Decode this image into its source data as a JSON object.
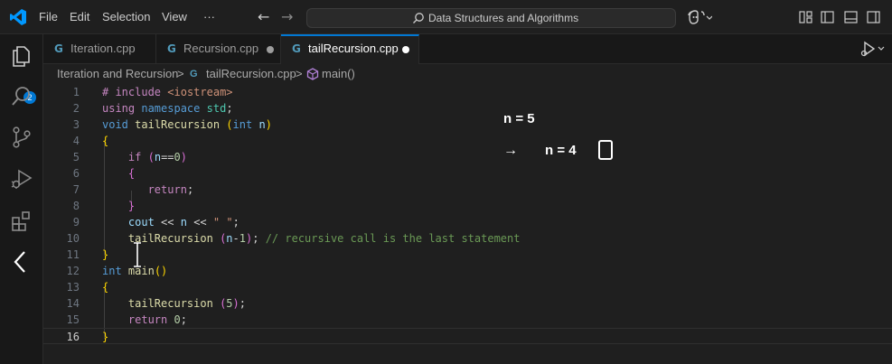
{
  "menu": {
    "items": [
      "File",
      "Edit",
      "Selection",
      "View"
    ],
    "more": "···"
  },
  "search": {
    "text": "Data Structures and Algorithms"
  },
  "tabs": [
    {
      "label": "Iteration.cpp",
      "dirty": false,
      "active": false
    },
    {
      "label": "Recursion.cpp",
      "dirty": true,
      "active": false
    },
    {
      "label": "tailRecursion.cpp",
      "dirty": true,
      "active": true
    }
  ],
  "breadcrumb": {
    "folder": "Iteration and Recursion",
    "sep": ">",
    "file": "tailRecursion.cpp",
    "symbol": "main()"
  },
  "explorer_badge": "2",
  "code": {
    "line_numbers": [
      "1",
      "2",
      "3",
      "4",
      "5",
      "6",
      "7",
      "8",
      "9",
      "10",
      "11",
      "12",
      "13",
      "14",
      "15",
      "16"
    ],
    "current_line": 16
  },
  "annotations": {
    "n5": "n = 5",
    "arrow": "→",
    "n4": "n = 4"
  },
  "colors": {
    "accent": "#0078d4",
    "editor_bg": "#1f1f1f",
    "keyword": "#569cd6",
    "function": "#dcdcaa",
    "comment": "#6a9955"
  },
  "icons": {
    "activity": [
      "explorer-icon",
      "search-icon",
      "source-control-icon",
      "run-debug-icon",
      "extensions-icon",
      "collapse-chevron-icon"
    ]
  }
}
